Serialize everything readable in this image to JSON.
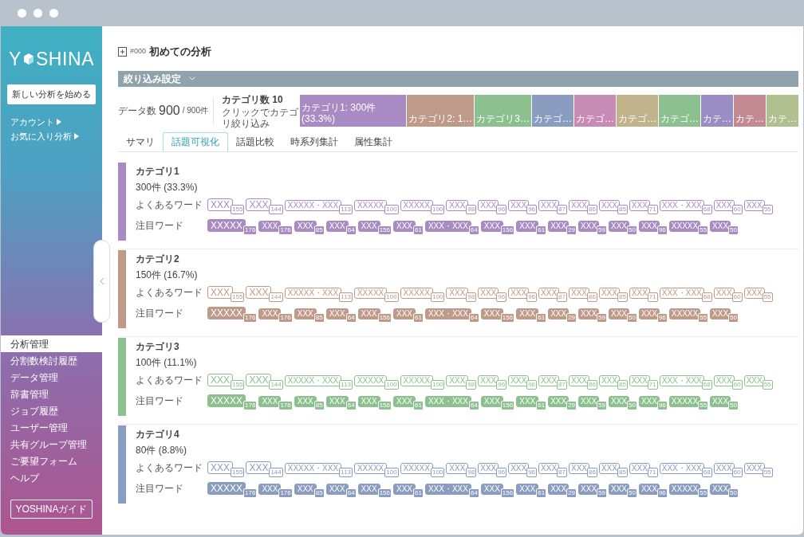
{
  "sidebar": {
    "logo": [
      "Y",
      "SHINA"
    ],
    "new_button": "新しい分析を始める",
    "links": [
      "アカウント",
      "お気に入り分析"
    ],
    "nav": [
      {
        "label": "分析管理",
        "selected": true
      },
      {
        "label": "分割数検討履歴",
        "selected": false
      },
      {
        "label": "データ管理",
        "selected": false
      },
      {
        "label": "辞書管理",
        "selected": false
      },
      {
        "label": "ジョブ履歴",
        "selected": false
      },
      {
        "label": "ユーザー管理",
        "selected": false
      },
      {
        "label": "共有グループ管理",
        "selected": false
      },
      {
        "label": "ご要望フォーム",
        "selected": false
      },
      {
        "label": "ヘルプ",
        "selected": false
      }
    ],
    "guide_button": "YOSHINAガイド"
  },
  "page": {
    "id": "#000",
    "title": "初めての分析"
  },
  "filter_bar": "絞り込み設定",
  "stats": {
    "label": "データ数",
    "value": "900",
    "total": "/ 900件",
    "category_count": "カテゴリ数 10",
    "hint": "クリックでカテゴリ絞り込み"
  },
  "segments": [
    {
      "label": "カテゴリ1: 300件 (33.3%)",
      "color": "#a98bc4"
    },
    {
      "label": "カテゴリ2: 1…",
      "color": "#c09a88"
    },
    {
      "label": "カテゴリ3…",
      "color": "#8cc18f"
    },
    {
      "label": "カテゴ…",
      "color": "#8a9cc0"
    },
    {
      "label": "カテゴ…",
      "color": "#c88bb5"
    },
    {
      "label": "カテゴ…",
      "color": "#c2b48a"
    },
    {
      "label": "カテゴ…",
      "color": "#8cc18f"
    },
    {
      "label": "カテ…",
      "color": "#9a8cc4"
    },
    {
      "label": "カテ…",
      "color": "#c48a94"
    },
    {
      "label": "カテ…",
      "color": "#b0c08e"
    }
  ],
  "tabs": [
    {
      "label": "サマリ",
      "selected": false
    },
    {
      "label": "話題可視化",
      "selected": true
    },
    {
      "label": "話題比較",
      "selected": false
    },
    {
      "label": "時系列集計",
      "selected": false
    },
    {
      "label": "属性集計",
      "selected": false
    }
  ],
  "categories": [
    {
      "name": "カテゴリ1",
      "count": "300件 (33.3%)",
      "color": "#a98bc4",
      "common_label": "よくあるワード",
      "notable_label": "注目ワード",
      "common": [
        [
          "XXX",
          "155"
        ],
        [
          "XXX",
          "144"
        ],
        [
          "XXXXX・XXX",
          "113"
        ],
        [
          "XXXXX",
          "100"
        ],
        [
          "XXXXX",
          "100"
        ],
        [
          "XXX",
          "98"
        ],
        [
          "XXX",
          "96"
        ],
        [
          "XXX",
          "96"
        ],
        [
          "XXX",
          "87"
        ],
        [
          "XXX",
          "86"
        ],
        [
          "XXX",
          "85"
        ],
        [
          "XXX",
          "71"
        ],
        [
          "XXX・XXX",
          "68"
        ],
        [
          "XXX",
          "60"
        ],
        [
          "XXX",
          "55"
        ]
      ],
      "notable": [
        [
          "XXXXX",
          "176"
        ],
        [
          "XXX",
          "176"
        ],
        [
          "XXX",
          "85"
        ],
        [
          "XXX",
          "64"
        ],
        [
          "XXX",
          "156"
        ],
        [
          "XXX",
          "61"
        ],
        [
          "XXX・XXX",
          "64"
        ],
        [
          "XXX",
          "156"
        ],
        [
          "XXX",
          "61"
        ],
        [
          "XXX",
          "29"
        ],
        [
          "XXX",
          "59"
        ],
        [
          "XXX",
          "50"
        ],
        [
          "XXX",
          "96"
        ],
        [
          "XXXXX",
          "55"
        ],
        [
          "XXX",
          "50"
        ]
      ]
    },
    {
      "name": "カテゴリ2",
      "count": "150件 (16.7%)",
      "color": "#c09a88",
      "common_label": "よくあるワード",
      "notable_label": "注目ワード",
      "common": [
        [
          "XXX",
          "155"
        ],
        [
          "XXX",
          "144"
        ],
        [
          "XXXXX・XXX",
          "113"
        ],
        [
          "XXXXX",
          "100"
        ],
        [
          "XXXXX",
          "100"
        ],
        [
          "XXX",
          "98"
        ],
        [
          "XXX",
          "96"
        ],
        [
          "XXX",
          "96"
        ],
        [
          "XXX",
          "87"
        ],
        [
          "XXX",
          "86"
        ],
        [
          "XXX",
          "85"
        ],
        [
          "XXX",
          "71"
        ],
        [
          "XXX・XXX",
          "68"
        ],
        [
          "XXX",
          "60"
        ],
        [
          "XXX",
          "55"
        ]
      ],
      "notable": [
        [
          "XXXXX",
          "176"
        ],
        [
          "XXX",
          "176"
        ],
        [
          "XXX",
          "85"
        ],
        [
          "XXX",
          "64"
        ],
        [
          "XXX",
          "156"
        ],
        [
          "XXX",
          "61"
        ],
        [
          "XXX・XXX",
          "64"
        ],
        [
          "XXX",
          "156"
        ],
        [
          "XXX",
          "61"
        ],
        [
          "XXX",
          "29"
        ],
        [
          "XXX",
          "59"
        ],
        [
          "XXX",
          "50"
        ],
        [
          "XXX",
          "96"
        ],
        [
          "XXXXX",
          "55"
        ],
        [
          "XXX",
          "50"
        ]
      ]
    },
    {
      "name": "カテゴリ3",
      "count": "100件 (11.1%)",
      "color": "#8cc18f",
      "common_label": "よくあるワード",
      "notable_label": "注目ワード",
      "common": [
        [
          "XXX",
          "155"
        ],
        [
          "XXX",
          "144"
        ],
        [
          "XXXXX・XXX",
          "113"
        ],
        [
          "XXXXX",
          "100"
        ],
        [
          "XXXXX",
          "100"
        ],
        [
          "XXX",
          "98"
        ],
        [
          "XXX",
          "96"
        ],
        [
          "XXX",
          "96"
        ],
        [
          "XXX",
          "87"
        ],
        [
          "XXX",
          "86"
        ],
        [
          "XXX",
          "85"
        ],
        [
          "XXX",
          "71"
        ],
        [
          "XXX・XXX",
          "68"
        ],
        [
          "XXX",
          "60"
        ],
        [
          "XXX",
          "55"
        ]
      ],
      "notable": [
        [
          "XXXXX",
          "176"
        ],
        [
          "XXX",
          "176"
        ],
        [
          "XXX",
          "85"
        ],
        [
          "XXX",
          "64"
        ],
        [
          "XXX",
          "156"
        ],
        [
          "XXX",
          "61"
        ],
        [
          "XXX・XXX",
          "64"
        ],
        [
          "XXX",
          "156"
        ],
        [
          "XXX",
          "61"
        ],
        [
          "XXX",
          "29"
        ],
        [
          "XXX",
          "59"
        ],
        [
          "XXX",
          "50"
        ],
        [
          "XXX",
          "96"
        ],
        [
          "XXXXX",
          "55"
        ],
        [
          "XXX",
          "50"
        ]
      ]
    },
    {
      "name": "カテゴリ4",
      "count": "80件 (8.8%)",
      "color": "#8a9cc0",
      "common_label": "よくあるワード",
      "notable_label": "注目ワード",
      "common": [
        [
          "XXX",
          "155"
        ],
        [
          "XXX",
          "144"
        ],
        [
          "XXXXX・XXX",
          "113"
        ],
        [
          "XXXXX",
          "100"
        ],
        [
          "XXXXX",
          "100"
        ],
        [
          "XXX",
          "98"
        ],
        [
          "XXX",
          "96"
        ],
        [
          "XXX",
          "96"
        ],
        [
          "XXX",
          "87"
        ],
        [
          "XXX",
          "86"
        ],
        [
          "XXX",
          "85"
        ],
        [
          "XXX",
          "71"
        ],
        [
          "XXX・XXX",
          "68"
        ],
        [
          "XXX",
          "60"
        ],
        [
          "XXX",
          "55"
        ]
      ],
      "notable": [
        [
          "XXXXX",
          "176"
        ],
        [
          "XXX",
          "176"
        ],
        [
          "XXX",
          "85"
        ],
        [
          "XXX",
          "64"
        ],
        [
          "XXX",
          "156"
        ],
        [
          "XXX",
          "61"
        ],
        [
          "XXX・XXX",
          "64"
        ],
        [
          "XXX",
          "156"
        ],
        [
          "XXX",
          "61"
        ],
        [
          "XXX",
          "29"
        ],
        [
          "XXX",
          "59"
        ],
        [
          "XXX",
          "50"
        ],
        [
          "XXX",
          "96"
        ],
        [
          "XXXXX",
          "55"
        ],
        [
          "XXX",
          "50"
        ]
      ]
    }
  ]
}
